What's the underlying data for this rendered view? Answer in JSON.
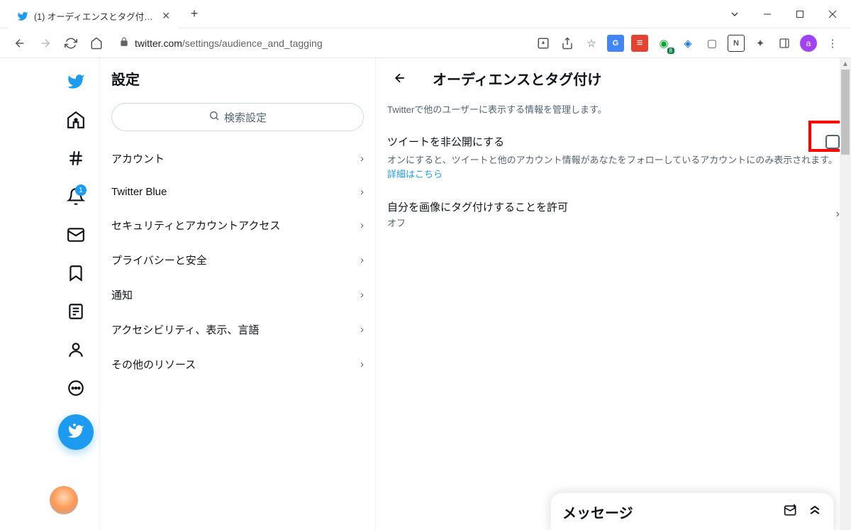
{
  "browser": {
    "tab_title": "(1) オーディエンスとタグ付け / Twitter",
    "url_domain": "twitter.com",
    "url_path": "/settings/audience_and_tagging",
    "avatar_letter": "a"
  },
  "ext_badge": "8",
  "leftnav": {
    "notif_count": "1"
  },
  "settings": {
    "heading": "設定",
    "search_placeholder": "検索設定",
    "items": [
      "アカウント",
      "Twitter Blue",
      "セキュリティとアカウントアクセス",
      "プライバシーと安全",
      "通知",
      "アクセシビリティ、表示、言語",
      "その他のリソース"
    ]
  },
  "detail": {
    "title": "オーディエンスとタグ付け",
    "description": "Twitterで他のユーザーに表示する情報を管理します。",
    "protect": {
      "label": "ツイートを非公開にする",
      "help_pre": "オンにすると、ツイートと他のアカウント情報があなたをフォローしているアカウントにのみ表示されます。 ",
      "help_link": "詳細はこちら"
    },
    "tagging": {
      "label": "自分を画像にタグ付けすることを許可",
      "status": "オフ"
    }
  },
  "messages": {
    "title": "メッセージ"
  }
}
